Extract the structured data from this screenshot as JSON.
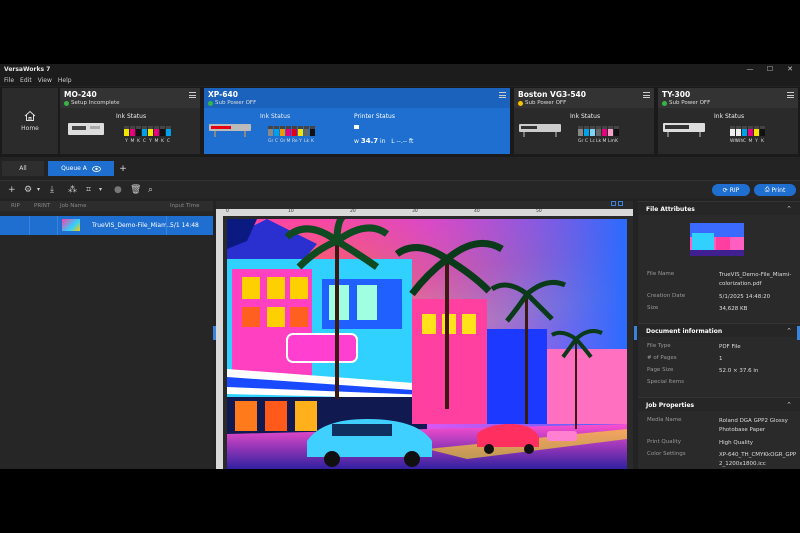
{
  "app": {
    "title": "VersaWorks 7",
    "window_controls": [
      "—",
      "☐",
      "✕"
    ]
  },
  "menu": [
    "File",
    "Edit",
    "View",
    "Help"
  ],
  "home": {
    "label": "Home"
  },
  "printers": [
    {
      "name": "MO-240",
      "status": "Setup Incomplete",
      "status_color": "#37b34a",
      "ink_label": "Ink Status",
      "inks": [
        {
          "n": "Y",
          "c": "#f5e400",
          "level": 0.7
        },
        {
          "n": "M",
          "c": "#e6007e",
          "level": 0.7
        },
        {
          "n": "K",
          "c": "#111111",
          "level": 0.7
        },
        {
          "n": "C",
          "c": "#00a0e9",
          "level": 0.7
        },
        {
          "n": "Y",
          "c": "#f5e400",
          "level": 0.7
        },
        {
          "n": "M",
          "c": "#e6007e",
          "level": 0.7
        },
        {
          "n": "K",
          "c": "#111111",
          "level": 0.7
        },
        {
          "n": "C",
          "c": "#00a0e9",
          "level": 0.7
        }
      ]
    },
    {
      "name": "XP-640",
      "status": "Sub Power OFF",
      "status_color": "#37b34a",
      "ink_label": "Ink Status",
      "printer_status_label": "Printer Status",
      "width_label": "w",
      "width_value": "34.7",
      "width_unit": "in",
      "length_label": "L --.-- ft",
      "inks": [
        {
          "n": "Gr",
          "c": "#888888",
          "level": 0.7
        },
        {
          "n": "C",
          "c": "#00a0e9",
          "level": 0.7
        },
        {
          "n": "Or",
          "c": "#f39800",
          "level": 0.7
        },
        {
          "n": "M",
          "c": "#e6007e",
          "level": 0.7
        },
        {
          "n": "Re",
          "c": "#e60012",
          "level": 0.7
        },
        {
          "n": "Y",
          "c": "#f5e400",
          "level": 0.7
        },
        {
          "n": "Lk",
          "c": "#666666",
          "level": 0.7
        },
        {
          "n": "K",
          "c": "#111111",
          "level": 0.7
        }
      ]
    },
    {
      "name": "Boston VG3-540",
      "status": "Sub Power OFF",
      "status_color": "#f5c400",
      "ink_label": "Ink Status",
      "inks": [
        {
          "n": "Gr",
          "c": "#888888",
          "level": 0.7
        },
        {
          "n": "C",
          "c": "#00a0e9",
          "level": 0.7
        },
        {
          "n": "Lc",
          "c": "#7fd3f7",
          "level": 0.7
        },
        {
          "n": "Lk",
          "c": "#666666",
          "level": 0.7
        },
        {
          "n": "M",
          "c": "#e6007e",
          "level": 0.7
        },
        {
          "n": "Lm",
          "c": "#f5a0c8",
          "level": 0.7
        },
        {
          "n": "K",
          "c": "#111111",
          "level": 0.7
        }
      ]
    },
    {
      "name": "TY-300",
      "status": "Sub Power OFF",
      "status_color": "#37b34a",
      "ink_label": "Ink Status",
      "inks": [
        {
          "n": "Wh",
          "c": "#eeeeee",
          "level": 0.7
        },
        {
          "n": "Wh",
          "c": "#eeeeee",
          "level": 0.7
        },
        {
          "n": "C",
          "c": "#00a0e9",
          "level": 0.7
        },
        {
          "n": "M",
          "c": "#e6007e",
          "level": 0.7
        },
        {
          "n": "Y",
          "c": "#f5e400",
          "level": 0.7
        },
        {
          "n": "K",
          "c": "#111111",
          "level": 0.7
        }
      ]
    }
  ],
  "tabs": {
    "all": "All",
    "queue": "Queue A",
    "add": "+"
  },
  "toolbar": {
    "rip_label": "RIP",
    "print_label": "Print"
  },
  "job_list": {
    "headers": [
      "RIP",
      "PRINT",
      "Job Name",
      "Input Time"
    ],
    "rows": [
      {
        "name": "TrueVIS_Demo-File_Miam...",
        "time": "5/1 14:48"
      }
    ]
  },
  "ruler": [
    "0",
    "10",
    "20",
    "30",
    "40",
    "50"
  ],
  "file_attributes": {
    "title": "File Attributes",
    "rows": [
      {
        "k": "File Name",
        "v": "TrueVIS_Demo-File_Miami-colorization.pdf"
      },
      {
        "k": "Creation Date",
        "v": "5/1/2025 14:48:20"
      },
      {
        "k": "Size",
        "v": "34,628 KB"
      }
    ]
  },
  "document_info": {
    "title": "Document information",
    "rows": [
      {
        "k": "File Type",
        "v": "PDF File"
      },
      {
        "k": "# of Pages",
        "v": "1"
      },
      {
        "k": "Page Size",
        "v": "52.0 × 37.6 in"
      },
      {
        "k": "Special Items",
        "v": ""
      }
    ]
  },
  "job_properties": {
    "title": "Job Properties",
    "rows": [
      {
        "k": "Media Name",
        "v": "Roland DGA GPP2 Glossy Photobase Paper"
      },
      {
        "k": "Print Quality",
        "v": "High Quality"
      },
      {
        "k": "Color Settings",
        "v": "XP-640_TH_CMYKkOGR_GPP2_1200x1800.icc"
      }
    ]
  }
}
